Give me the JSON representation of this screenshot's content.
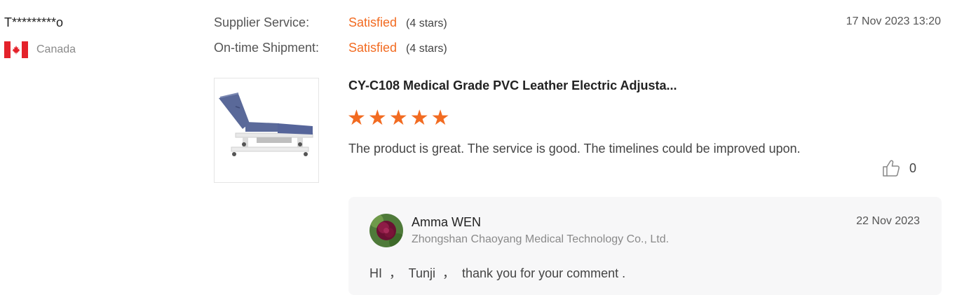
{
  "reviewer": {
    "name": "T*********o",
    "country": "Canada",
    "flag_icon": "canada-flag-icon",
    "flag_colors": {
      "red": "#e4222b",
      "white": "#ffffff"
    }
  },
  "ratings": [
    {
      "label": "Supplier Service:",
      "value": "Satisfied",
      "stars_text": "(4 stars)"
    },
    {
      "label": "On-time Shipment:",
      "value": "Satisfied",
      "stars_text": "(4 stars)"
    }
  ],
  "review": {
    "date": "17 Nov 2023 13:20",
    "product_title": "CY-C108 Medical Grade PVC Leather Electric Adjusta...",
    "star_rating": 5,
    "text": "The product is great. The service is good. The timelines could be improved upon.",
    "like_count": "0",
    "like_icon": "thumbs-up-icon"
  },
  "reply": {
    "name": "Amma WEN",
    "company": "Zhongshan Chaoyang Medical Technology Co., Ltd.",
    "date": "22 Nov 2023",
    "text": "HI  ，  Tunji  ，  thank you for your comment ."
  },
  "colors": {
    "accent": "#f26b21",
    "reply_bg": "#f7f7f8"
  }
}
